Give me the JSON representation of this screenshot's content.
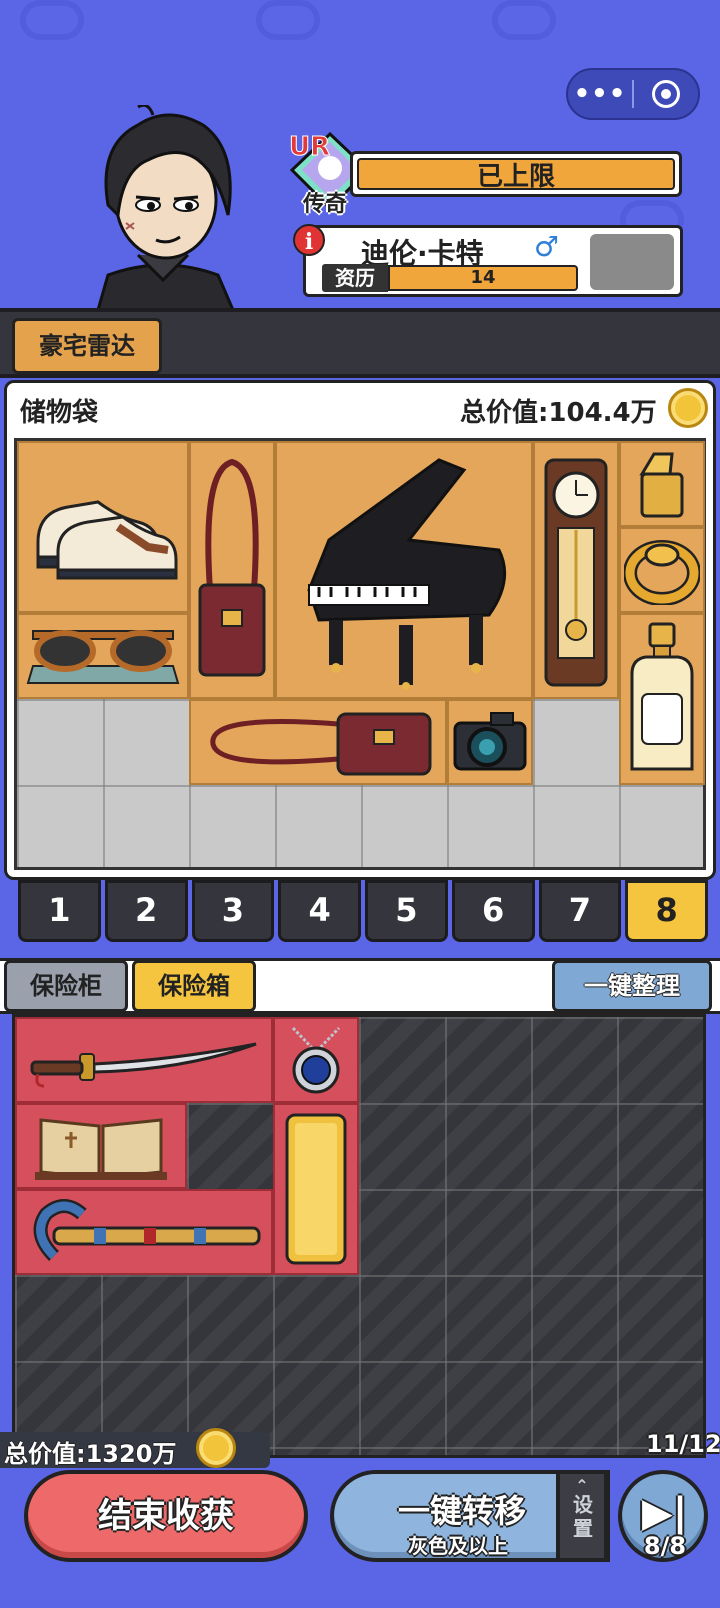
{
  "colors": {
    "background": "#5b66e6",
    "gold": "#f5c53f",
    "item_orange": "#e3a65a",
    "item_red": "#d5505c",
    "end_button": "#ee6a6a",
    "transfer_button": "#8fb5de"
  },
  "header": {
    "rarity_code": "UR",
    "rarity_name": "传奇",
    "level_status": "已上限",
    "character": {
      "name": "迪伦·卡特",
      "gender_icon": "male-icon",
      "gender_symbol": "♂",
      "info_symbol": "i",
      "exp_label": "资历",
      "exp_value": "14"
    }
  },
  "band": {
    "radar_button": "豪宅雷达"
  },
  "bag": {
    "title": "储物袋",
    "total_value": "总价值:104.4万",
    "items": [
      {
        "name": "sneakers",
        "icon": "sneakers-icon"
      },
      {
        "name": "handbag",
        "icon": "handbag-icon"
      },
      {
        "name": "grand-piano",
        "icon": "piano-icon"
      },
      {
        "name": "grandfather-clock",
        "icon": "clock-icon"
      },
      {
        "name": "lighter",
        "icon": "lighter-icon"
      },
      {
        "name": "gold-ring",
        "icon": "ring-icon"
      },
      {
        "name": "sunglasses",
        "icon": "sunglasses-icon"
      },
      {
        "name": "perfume",
        "icon": "perfume-icon"
      },
      {
        "name": "shoulder-bag",
        "icon": "shoulder-bag-icon"
      },
      {
        "name": "camera",
        "icon": "camera-icon"
      }
    ]
  },
  "pages": [
    "1",
    "2",
    "3",
    "4",
    "5",
    "6",
    "7",
    "8"
  ],
  "active_page": "8",
  "safe": {
    "tab_cabinet": "保险柜",
    "tab_box": "保险箱",
    "sort_button": "一键整理",
    "total_value": "总价值:1320万",
    "capacity": "11/12",
    "items": [
      {
        "name": "katana",
        "icon": "sword-icon"
      },
      {
        "name": "sapphire-necklace",
        "icon": "necklace-icon"
      },
      {
        "name": "ancient-book",
        "icon": "book-icon"
      },
      {
        "name": "gold-bar",
        "icon": "gold-bar-icon"
      },
      {
        "name": "crook-staff",
        "icon": "staff-icon"
      }
    ]
  },
  "footer": {
    "end_button": "结束收获",
    "transfer_button": "一键转移",
    "transfer_sub": "灰色及以上",
    "settings_label": "设置",
    "skip_count": "8/8"
  }
}
